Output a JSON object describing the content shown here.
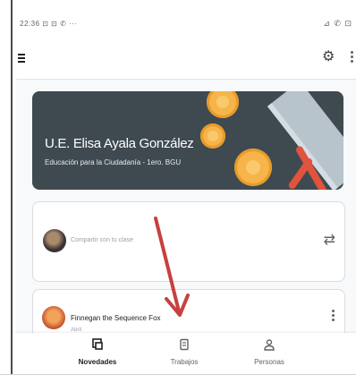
{
  "status_bar": {
    "left": "22:36 ⊡ ⊡ ✆ ···",
    "right": "⊿ ✆ ⊡"
  },
  "appbar": {
    "menu_icon": "menu-icon",
    "settings_icon": "gear-icon",
    "more_icon": "more-vert-icon"
  },
  "banner": {
    "title": "U.E. Elisa Ayala González",
    "subtitle": "Educación para la Ciudadanía - 1ero. BGU",
    "background": "#3e4a50"
  },
  "share_card": {
    "placeholder": "Compartir con tu clase",
    "action_icon": "repost-icon"
  },
  "post_card": {
    "title": "Finnegan the Sequence Fox",
    "subtitle": "Abril",
    "more_icon": "more-vert-icon"
  },
  "bottom_nav": {
    "items": [
      {
        "label": "Novedades",
        "icon": "stream-icon",
        "active": true
      },
      {
        "label": "Trabajos",
        "icon": "classwork-icon",
        "active": false
      },
      {
        "label": "Personas",
        "icon": "people-icon",
        "active": false
      }
    ]
  },
  "annotation": {
    "color": "#c7403f"
  }
}
